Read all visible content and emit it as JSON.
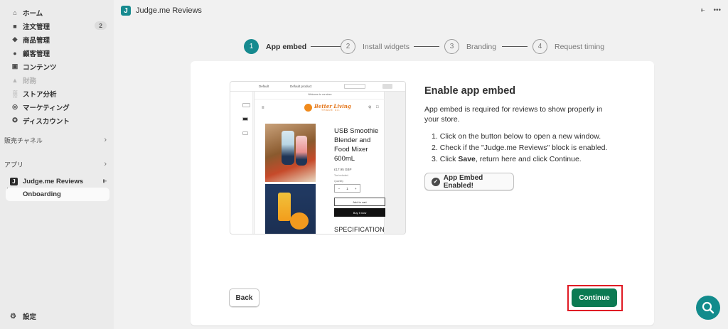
{
  "sidebar": {
    "items": [
      {
        "label": "ホーム",
        "icon": "home-icon"
      },
      {
        "label": "注文管理",
        "icon": "inbox-icon",
        "badge": "2"
      },
      {
        "label": "商品管理",
        "icon": "tag-icon"
      },
      {
        "label": "顧客管理",
        "icon": "person-icon"
      },
      {
        "label": "コンテンツ",
        "icon": "content-icon"
      },
      {
        "label": "財務",
        "icon": "bank-icon",
        "disabled": true
      },
      {
        "label": "ストア分析",
        "icon": "bar-chart-icon"
      },
      {
        "label": "マーケティング",
        "icon": "target-icon"
      },
      {
        "label": "ディスカウント",
        "icon": "discount-icon"
      }
    ],
    "sales_channels_label": "販売チャネル",
    "apps_label": "アプリ",
    "app_name": "Judge.me Reviews",
    "app_sub_item": "Onboarding",
    "settings_label": "設定"
  },
  "topbar": {
    "title": "Judge.me Reviews",
    "app_icon_letter": "J"
  },
  "stepper": [
    {
      "number": "1",
      "label": "App embed",
      "active": true
    },
    {
      "number": "2",
      "label": "Install widgets",
      "active": false
    },
    {
      "number": "3",
      "label": "Branding",
      "active": false
    },
    {
      "number": "4",
      "label": "Request timing",
      "active": false
    }
  ],
  "preview": {
    "announcement": "Welcome to our store",
    "brand": "Better Living",
    "brand_sub": "TRADE Co.",
    "product_title": "USB Smoothie Blender and Food Mixer 600mL",
    "price": "£17.95 GBP",
    "tax_note": "Tax included.",
    "quantity_label": "Quantity",
    "quantity": "1",
    "add_to_cart": "Add to cart",
    "buy_now": "Buy it now",
    "spec_heading": "SPECIFICATION",
    "toolbar_default": "Default",
    "toolbar_product": "Default product"
  },
  "content": {
    "heading": "Enable app embed",
    "description": "App embed is required for reviews to show properly in your store.",
    "steps": [
      {
        "num": "1.",
        "text": "Click on the button below to open a new window."
      },
      {
        "num": "2.",
        "text": "Check if the \"Judge.me Reviews\" block is enabled."
      },
      {
        "num": "3.",
        "pre": "Click ",
        "bold": "Save",
        "post": ", return here and click Continue."
      }
    ],
    "embed_button": "App Embed Enabled!"
  },
  "footer": {
    "back": "Back",
    "continue": "Continue"
  },
  "colors": {
    "accent": "#168a8f",
    "continue": "#0b7a52",
    "highlight": "#e01b24",
    "fab": "#128b8c"
  }
}
